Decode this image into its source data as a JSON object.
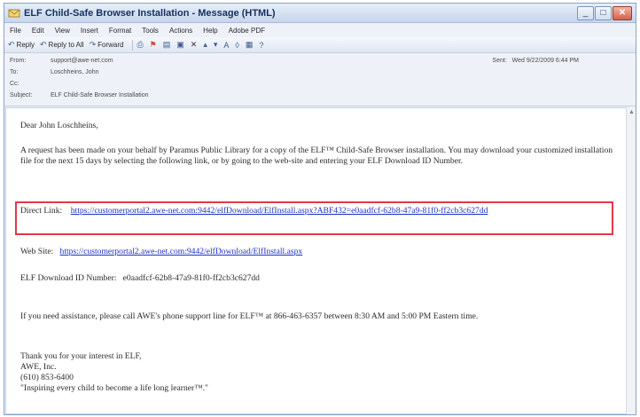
{
  "window": {
    "title": "ELF Child-Safe Browser Installation - Message (HTML)",
    "controls": {
      "minimize": "_",
      "maximize": "□",
      "close": "✕"
    }
  },
  "menubar": [
    "File",
    "Edit",
    "View",
    "Insert",
    "Format",
    "Tools",
    "Actions",
    "Help",
    "Adobe PDF"
  ],
  "toolbar": {
    "reply": "Reply",
    "reply_all": "Reply to All",
    "forward": "Forward"
  },
  "headers": {
    "from_label": "From:",
    "from_value": "support@awe-net.com",
    "to_label": "To:",
    "to_value": "Loschheins, John",
    "cc_label": "Cc:",
    "cc_value": "",
    "subject_label": "Subject:",
    "subject_value": "ELF Child-Safe Browser Installation",
    "sent_label": "Sent:",
    "sent_value": "Wed 9/22/2009 6:44 PM"
  },
  "body": {
    "greeting": "Dear John Loschheins,",
    "intro": "A request has been made on your behalf by Paramus Public Library for a copy of the ELF™ Child-Safe Browser installation.  You may download your customized installation file for the next 15 days by selecting the following link, or by going to the web-site and entering your ELF Download ID Number.",
    "direct_label": "Direct Link:",
    "direct_url": "https://customerportal2.awe-net.com:9442/elfDownload/ElfInstall.aspx?ABF432=e0aadfcf-62b8-47a9-81f0-ff2cb3c627dd",
    "web_label": "Web Site:",
    "web_url": "https://customerportal2.awe-net.com:9442/elfDownload/ElfInstall.aspx",
    "id_label": "ELF Download ID Number:",
    "id_value": "e0aadfcf-62b8-47a9-81f0-ff2cb3c627dd",
    "assistance": "If you need assistance, please call AWE's phone support line for ELF™ at 866-463-6357 between 8:30 AM and 5:00 PM Eastern time.",
    "thanks": "Thank you for your interest in ELF,",
    "company": "AWE, Inc.",
    "phone": "(610) 853-6400",
    "tagline": "\"Inspiring every child to become a life long learner™.\""
  }
}
